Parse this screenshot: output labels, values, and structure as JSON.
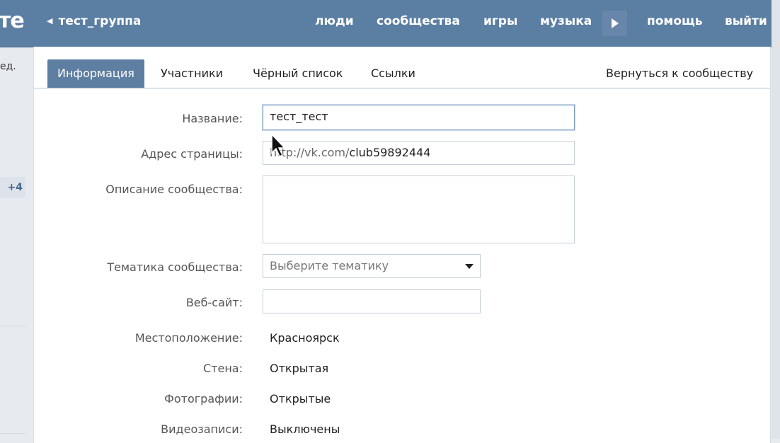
{
  "header": {
    "logo": "те",
    "back_label": "тест_группа",
    "nav": [
      "люди",
      "сообщества",
      "игры",
      "музыка",
      "помощь",
      "выйти"
    ]
  },
  "sidebar": {
    "fragment": "ед.",
    "badge": "+4"
  },
  "tabs": [
    "Информация",
    "Участники",
    "Чёрный список",
    "Ссылки"
  ],
  "tab_right": "Вернуться к сообществу",
  "form": {
    "name_label": "Название:",
    "name_value": "тест_тест",
    "address_label": "Адрес страницы:",
    "address_prefix": "http://vk.com/",
    "address_value": "club59892444",
    "description_label": "Описание сообщества:",
    "description_value": "",
    "topic_label": "Тематика сообщества:",
    "topic_placeholder": "Выберите тематику",
    "website_label": "Веб-сайт:",
    "website_value": "",
    "location_label": "Местоположение:",
    "location_value": "Красноярск",
    "wall_label": "Стена:",
    "wall_value": "Открытая",
    "photos_label": "Фотографии:",
    "photos_value": "Открытые",
    "videos_label": "Видеозаписи:",
    "videos_value": "Выключены"
  },
  "colors": {
    "topbar": "#5b7ea3",
    "active_tab": "#5f7fa2",
    "page_bg": "#e7ebf0"
  }
}
